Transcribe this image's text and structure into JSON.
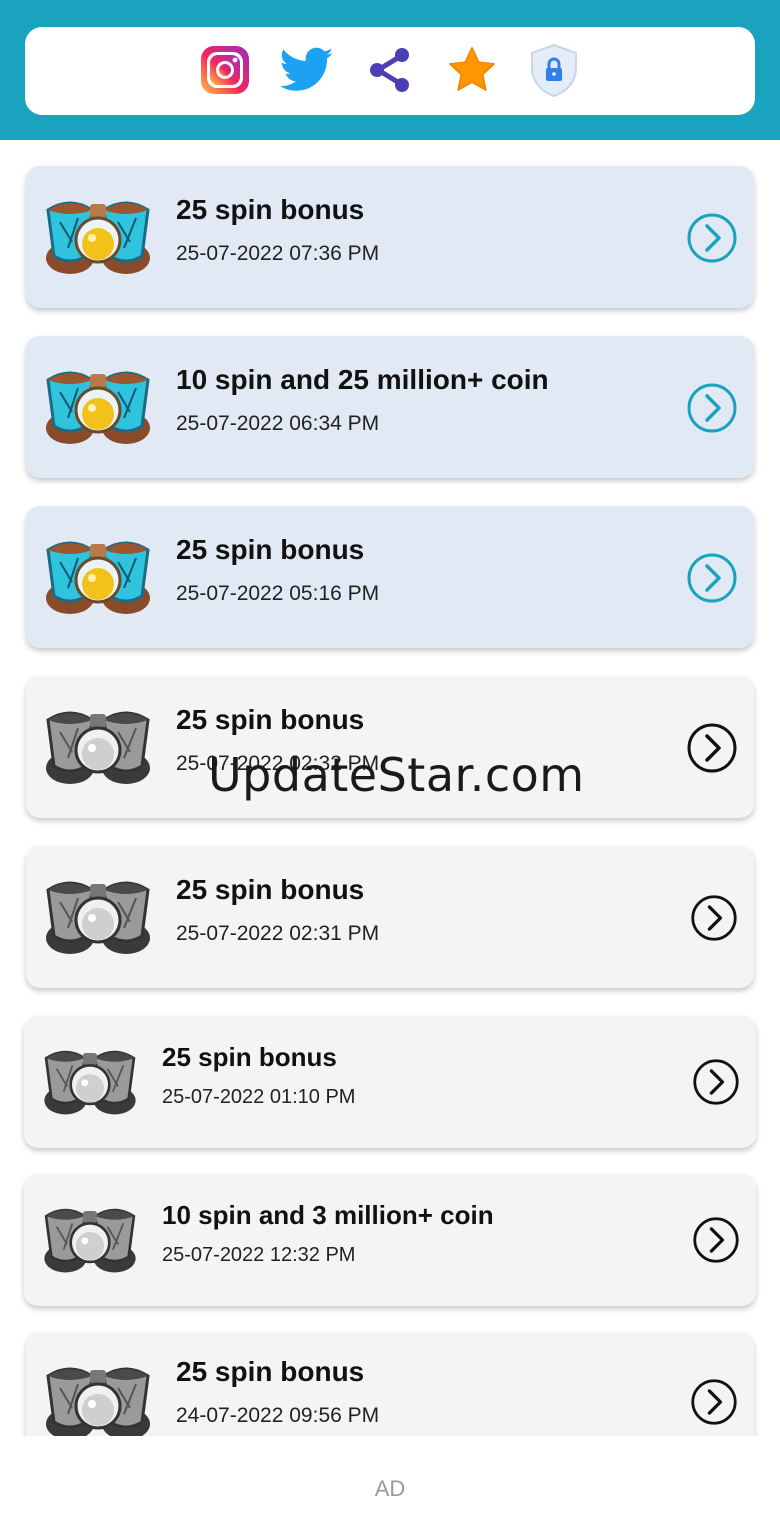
{
  "toolbar": {
    "icons": [
      {
        "name": "instagram-icon",
        "color": "#d6249f"
      },
      {
        "name": "twitter-icon",
        "color": "#1da1f2"
      },
      {
        "name": "share-icon",
        "color": "#4a3fb5"
      },
      {
        "name": "star-icon",
        "color": "#ff9800"
      },
      {
        "name": "privacy-shield-icon",
        "color": "#2f80ed"
      }
    ],
    "accent_color": "#1aa3bf"
  },
  "rewards": [
    {
      "title": "25 spin bonus",
      "date": "25-07-2022 07:36 PM",
      "state": "active"
    },
    {
      "title": "10 spin and 25 million+ coin",
      "date": "25-07-2022 06:34 PM",
      "state": "active"
    },
    {
      "title": "25 spin bonus",
      "date": "25-07-2022 05:16 PM",
      "state": "active"
    },
    {
      "title": "25 spin bonus",
      "date": "25-07-2022 02:32 PM",
      "state": "used"
    },
    {
      "title": "25 spin bonus",
      "date": "25-07-2022 02:31 PM",
      "state": "used"
    },
    {
      "title": "25 spin bonus",
      "date": "25-07-2022 01:10 PM",
      "state": "used"
    },
    {
      "title": "10 spin and 3 million+ coin",
      "date": "25-07-2022 12:32 PM",
      "state": "used"
    },
    {
      "title": "25 spin bonus",
      "date": "24-07-2022 09:56 PM",
      "state": "used"
    }
  ],
  "colors": {
    "active_card": "#e1eaf4",
    "used_card": "#f4f4f4",
    "active_arrow": "#1aa3bf",
    "used_arrow": "#111111"
  },
  "watermark": "UpdateStar.com",
  "ad_label": "AD"
}
